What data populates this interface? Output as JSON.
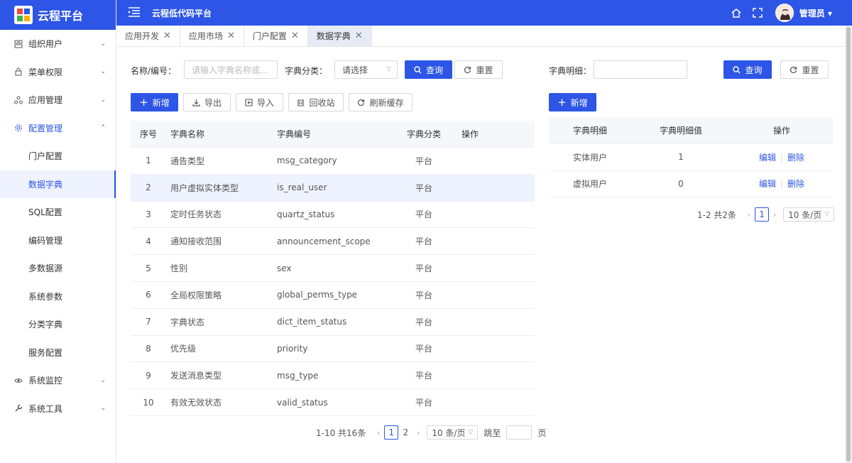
{
  "brand": {
    "name": "云程平台"
  },
  "header": {
    "title": "云程低代码平台",
    "user": "管理员"
  },
  "sidebar": {
    "items": [
      {
        "label": "组织用户",
        "icon": "org-icon",
        "arrow": "⌄"
      },
      {
        "label": "菜单权限",
        "icon": "lock-icon",
        "arrow": "⌄"
      },
      {
        "label": "应用管理",
        "icon": "app-icon",
        "arrow": "⌄"
      },
      {
        "label": "配置管理",
        "icon": "gear-icon",
        "arrow": "⌃"
      }
    ],
    "sub_items": [
      "门户配置",
      "数据字典",
      "SQL配置",
      "编码管理",
      "多数据源",
      "系统参数",
      "分类字典",
      "服务配置"
    ],
    "bottom_items": [
      {
        "label": "系统监控",
        "icon": "eye-icon",
        "arrow": "⌄"
      },
      {
        "label": "系统工具",
        "icon": "wrench-icon",
        "arrow": "⌄"
      }
    ]
  },
  "tabs": [
    {
      "label": "应用开发",
      "close": "✕"
    },
    {
      "label": "应用市场",
      "close": "✕"
    },
    {
      "label": "门户配置",
      "close": "✕"
    },
    {
      "label": "数据字典",
      "close": "✕"
    }
  ],
  "filters": {
    "name_label": "名称/编号：",
    "name_placeholder": "请输入字典名称或...",
    "category_label": "字典分类：",
    "category_value": "请选择",
    "query": "查询",
    "reset": "重置",
    "detail_label": "字典明细：",
    "detail_placeholder": ""
  },
  "toolbar": {
    "add": "新增",
    "export": "导出",
    "import": "导入",
    "recycle": "回收站",
    "refresh": "刷新缓存",
    "add_right": "新增"
  },
  "table": {
    "columns": [
      "序号",
      "字典名称",
      "字典编号",
      "字典分类",
      "操作"
    ],
    "rows": [
      [
        "1",
        "通告类型",
        "msg_category",
        "平台"
      ],
      [
        "2",
        "用户虚拟实体类型",
        "is_real_user",
        "平台"
      ],
      [
        "3",
        "定时任务状态",
        "quartz_status",
        "平台"
      ],
      [
        "4",
        "通知接收范围",
        "announcement_scope",
        "平台"
      ],
      [
        "5",
        "性别",
        "sex",
        "平台"
      ],
      [
        "6",
        "全局权限策略",
        "global_perms_type",
        "平台"
      ],
      [
        "7",
        "字典状态",
        "dict_item_status",
        "平台"
      ],
      [
        "8",
        "优先级",
        "priority",
        "平台"
      ],
      [
        "9",
        "发送消息类型",
        "msg_type",
        "平台"
      ],
      [
        "10",
        "有效无效状态",
        "valid_status",
        "平台"
      ]
    ]
  },
  "right_table": {
    "columns": [
      "字典明细",
      "字典明细值",
      "操作"
    ],
    "rows": [
      {
        "name": "实体用户",
        "value": "1",
        "edit": "编辑",
        "sep": "|",
        "del": "删除"
      },
      {
        "name": "虚拟用户",
        "value": "0",
        "edit": "编辑",
        "sep": "|",
        "del": "删除"
      }
    ]
  },
  "pagination": {
    "summary": "1-10 共16条",
    "pages": [
      "1",
      "2"
    ],
    "page_size": "10 条/页",
    "jump_label": "跳至",
    "jump_unit": "页"
  },
  "right_pagination": {
    "summary": "1-2 共2条",
    "pages": [
      "1"
    ],
    "page_size": "10 条/页"
  }
}
